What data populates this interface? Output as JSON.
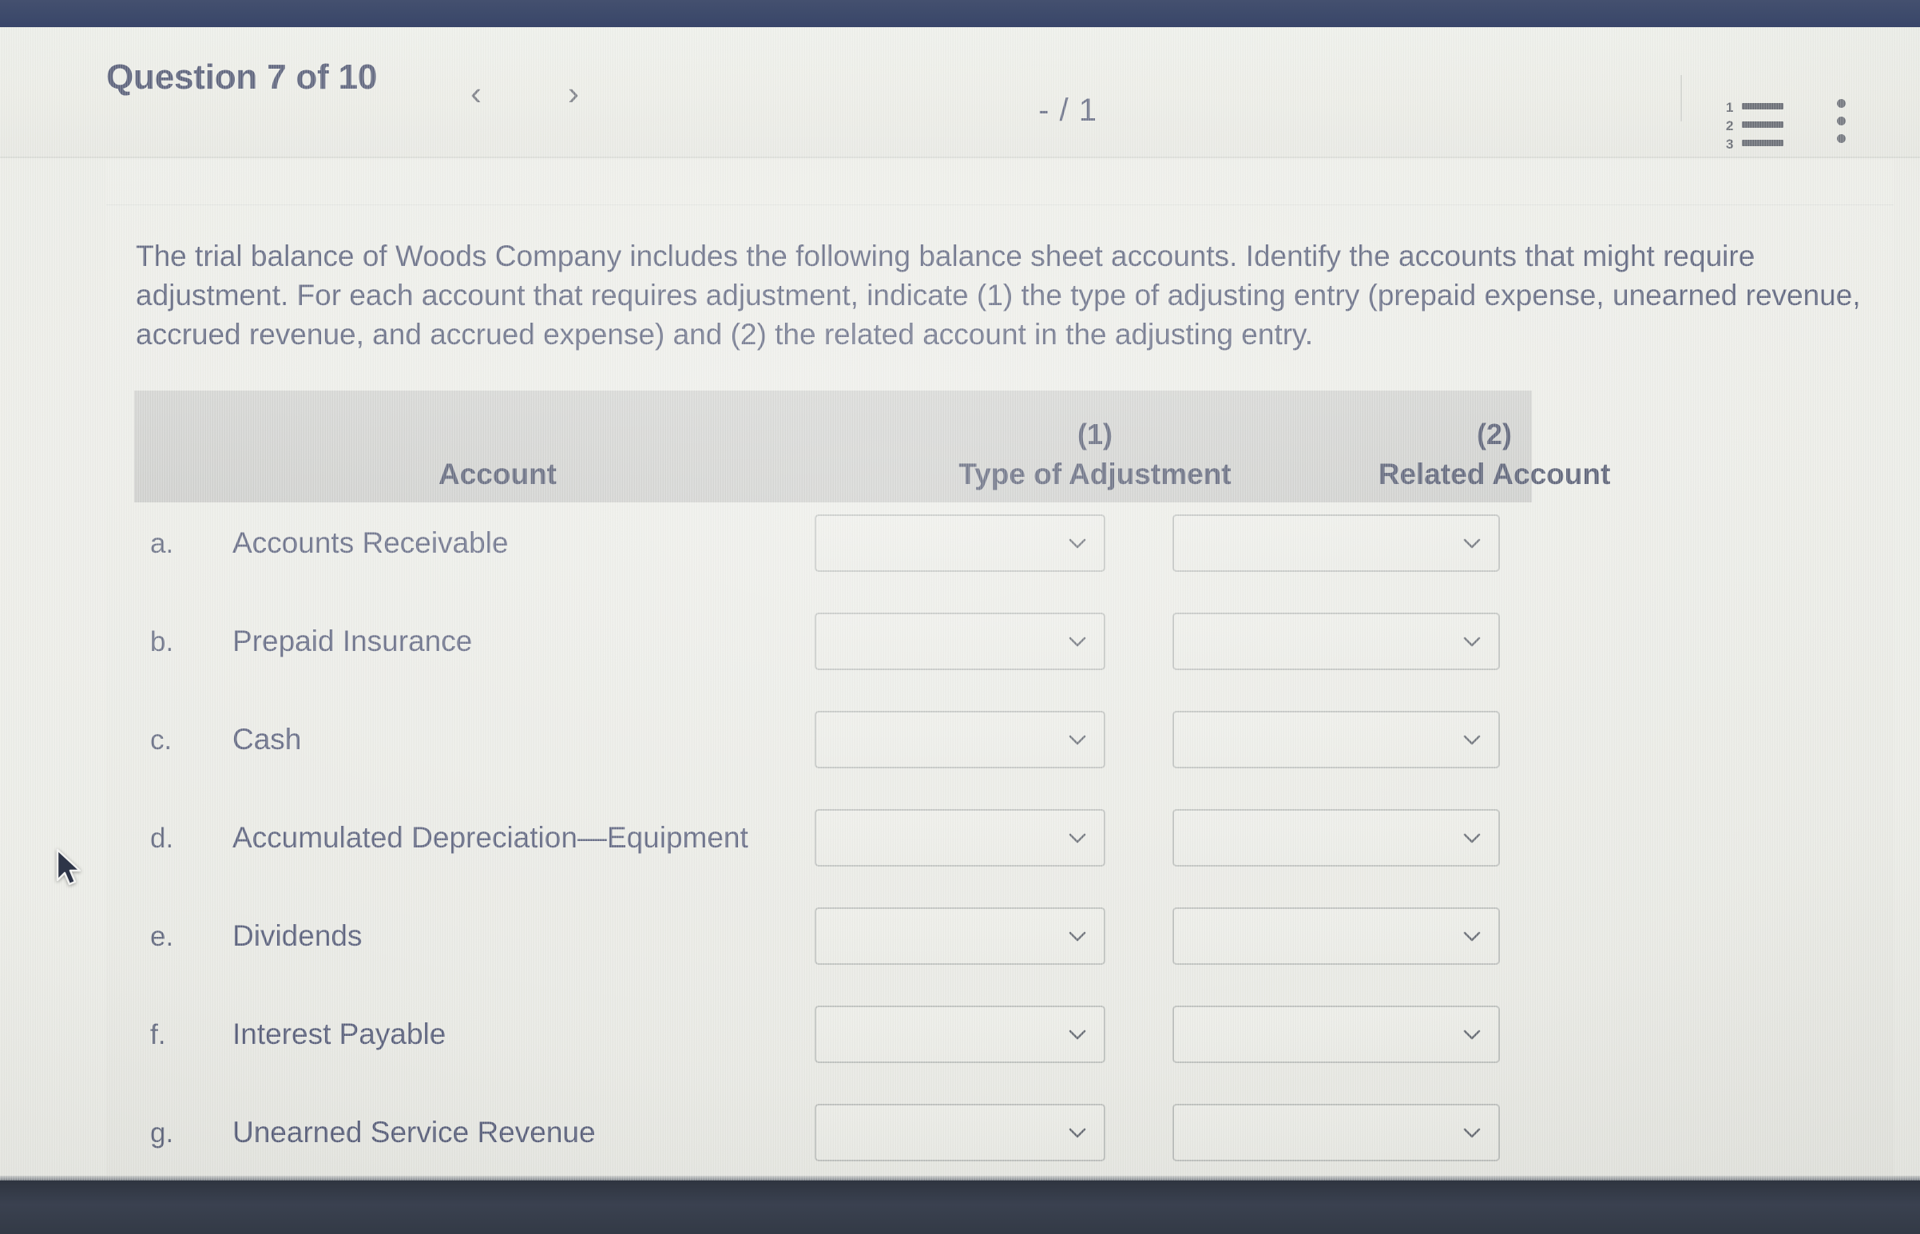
{
  "header": {
    "title": "Question 7 of 10",
    "prev_label": "‹",
    "next_label": "›",
    "score": "- / 1",
    "list_icon_name": "numbered-list-icon",
    "list_icon_digits": [
      "1",
      "2",
      "3"
    ],
    "menu_icon_name": "more-options-icon"
  },
  "question": {
    "prompt": "The trial balance of Woods Company includes the following balance sheet accounts. Identify the accounts that might require adjustment. For each account that requires adjustment, indicate (1) the type of adjusting entry (prepaid expense, unearned revenue, accrued revenue, and accrued expense) and (2) the related account in the adjusting entry."
  },
  "table": {
    "headers": {
      "account": "Account",
      "col1_number": "(1)",
      "col1_label": "Type of Adjustment",
      "col2_number": "(2)",
      "col2_label": "Related Account"
    },
    "rows": [
      {
        "letter": "a.",
        "account": "Accounts Receivable",
        "type_of_adjustment": "",
        "related_account": ""
      },
      {
        "letter": "b.",
        "account": "Prepaid Insurance",
        "type_of_adjustment": "",
        "related_account": ""
      },
      {
        "letter": "c.",
        "account": "Cash",
        "type_of_adjustment": "",
        "related_account": ""
      },
      {
        "letter": "d.",
        "account": "Accumulated Depreciation—Equipment",
        "type_of_adjustment": "",
        "related_account": ""
      },
      {
        "letter": "e.",
        "account": "Dividends",
        "type_of_adjustment": "",
        "related_account": ""
      },
      {
        "letter": "f.",
        "account": "Interest Payable",
        "type_of_adjustment": "",
        "related_account": ""
      },
      {
        "letter": "g.",
        "account": "Unearned Service Revenue",
        "type_of_adjustment": "",
        "related_account": ""
      }
    ]
  },
  "colors": {
    "chrome_top": "#3e4c6e",
    "chrome_bottom": "#383e49",
    "page_background": "#e9eae4",
    "table_header": "#c9cac7",
    "text": "#4d5470",
    "select_border": "#b9bcb9"
  }
}
